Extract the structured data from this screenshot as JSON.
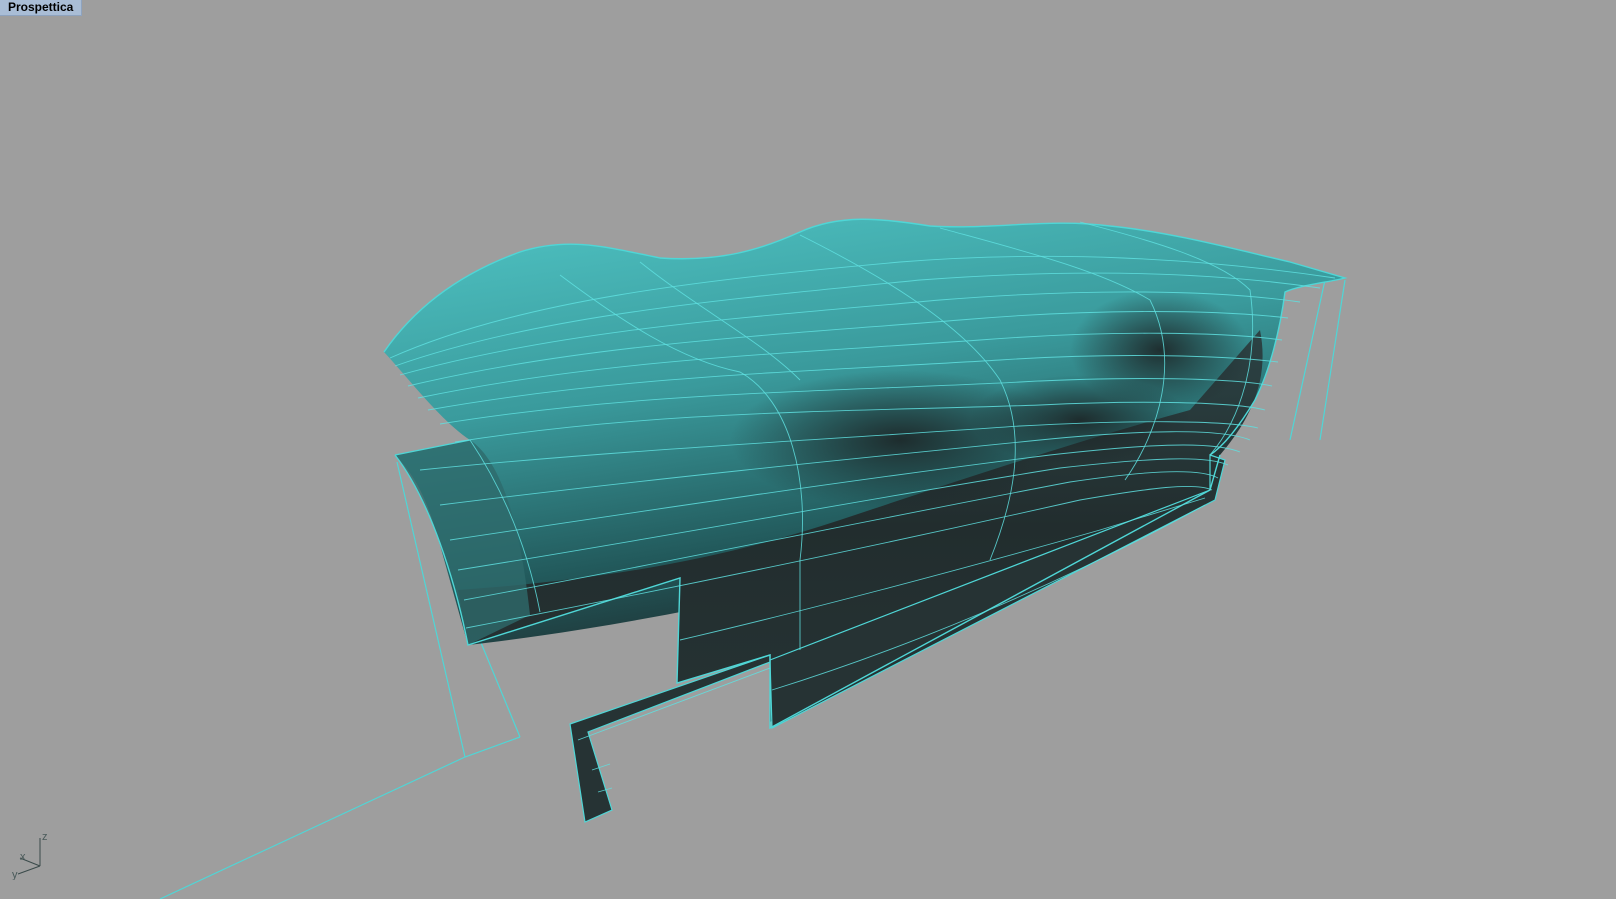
{
  "viewport": {
    "label": "Prospettica",
    "background": "#9e9e9e",
    "wire_color": "#4fd6d6"
  },
  "axis_gizmo": {
    "z_label": "z",
    "x_label": "x",
    "y_label": "y"
  }
}
